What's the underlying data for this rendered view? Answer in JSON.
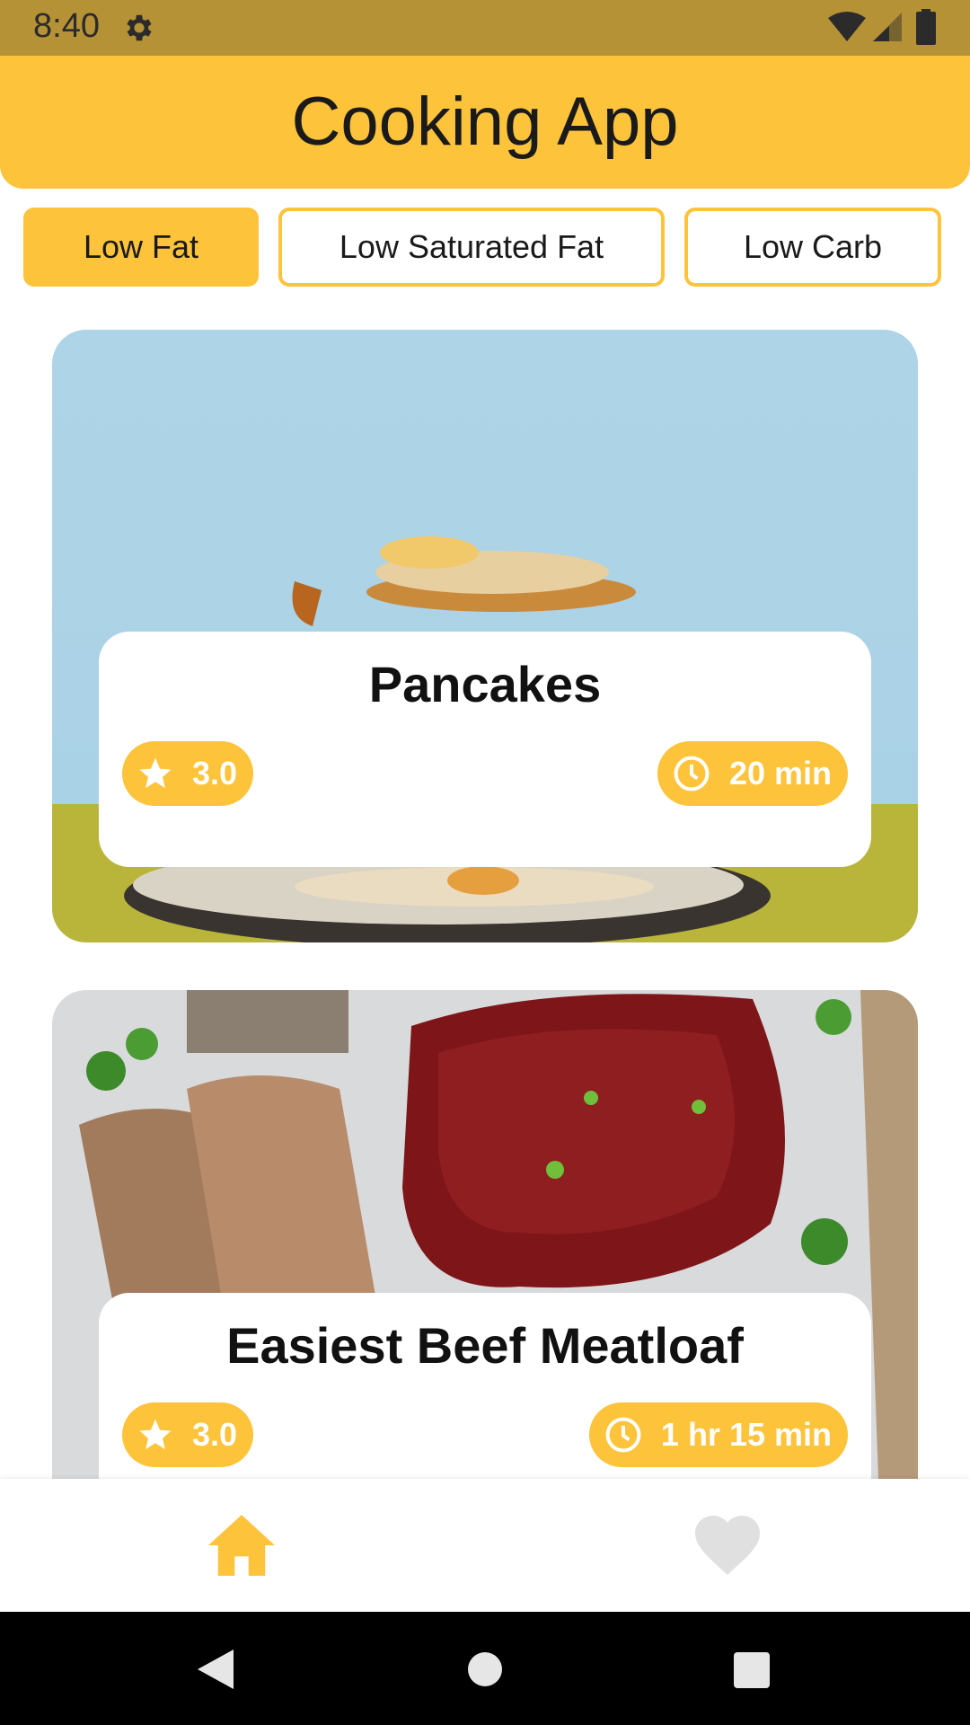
{
  "status_bar": {
    "time": "8:40",
    "icons": [
      "gear-icon",
      "wifi-icon",
      "signal-icon",
      "battery-icon"
    ]
  },
  "header": {
    "title": "Cooking App"
  },
  "filters": [
    {
      "label": "Low Fat",
      "active": true
    },
    {
      "label": "Low Saturated Fat",
      "active": false
    },
    {
      "label": "Low Carb",
      "active": false
    }
  ],
  "recipes": [
    {
      "name": "Pancakes",
      "rating": "3.0",
      "time": "20 min"
    },
    {
      "name": "Easiest Beef Meatloaf",
      "rating": "3.0",
      "time": "1 hr 15 min"
    }
  ],
  "bottom_nav": [
    {
      "icon": "home-icon",
      "selected": true
    },
    {
      "icon": "heart-icon",
      "selected": false
    }
  ],
  "colors": {
    "accent": "#fdc33b",
    "status_bar": "#b69236",
    "inactive_icon": "#e0e0e0"
  }
}
